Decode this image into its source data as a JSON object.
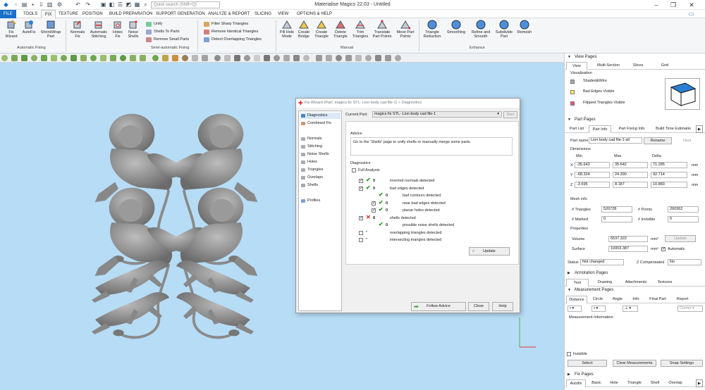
{
  "app": {
    "title": "Materialise Magics 22.03 - Untitled",
    "search_placeholder": "Quick search (Shift+Q)"
  },
  "menu": [
    "FILE",
    "TOOLS",
    "FIX",
    "TEXTURE",
    "POSITION",
    "BUILD PREPARATION",
    "SUPPORT GENERATION",
    "ANALYZE & REPORT",
    "SLICING",
    "VIEW",
    "OPTIONS & HELP"
  ],
  "ribbon": {
    "auto_fixing": {
      "label": "Automatic Fixing",
      "buttons": [
        "Fix\nWizard",
        "AutoFix",
        "ShrinkWrap\nPart"
      ]
    },
    "semi": {
      "label": "Semi-automatic Fixing",
      "large": [
        "Normals\nFix",
        "Automatic\nStitching",
        "Holes\nFix",
        "Noise\nShells"
      ],
      "small": [
        "Unify",
        "Shells To Parts",
        "Remove Small Parts"
      ]
    },
    "filters": [
      "Filter Sharp Triangles",
      "Remove Identical Triangles",
      "Detect Overlapping Triangles"
    ],
    "manual": {
      "label": "Manual",
      "buttons": [
        "Pill Hole\nMode",
        "Create\nBridge",
        "Create\nTriangle",
        "Delete\nTriangle",
        "Trim\nTriangles",
        "Translate\nPart Points",
        "Move Part\nPoints"
      ]
    },
    "enhance": {
      "label": "Enhance",
      "buttons": [
        "Triangle\nReduction",
        "Smoothing",
        "Refine and\nSmooth",
        "Subdivide\nPart",
        "Remesh"
      ]
    }
  },
  "view_pages": {
    "header": "View Pages",
    "tabs": [
      "View",
      "Multi-Section",
      "Slices",
      "Grid"
    ],
    "visualization_label": "Visualization",
    "items": [
      "Shaded&Wire",
      "Bad Edges Visible",
      "Flipped Triangles Visible"
    ]
  },
  "part_pages": {
    "header": "Part Pages",
    "tabs": [
      "Part List",
      "Part Info",
      "Part Fixing Info",
      "Build Time Estimatio"
    ],
    "part_name_label": "Part name",
    "part_name": "Lion body cad file-1-stl",
    "rename": "Rename",
    "next": "Next",
    "dimensions_label": "Dimensions",
    "col_heads": [
      "Min",
      "Max",
      "Delta"
    ],
    "rows": [
      {
        "axis": "X",
        "min": "-35.642",
        "max": "35.642",
        "delta": "71.285",
        "unit": "mm"
      },
      {
        "axis": "Y",
        "min": "-68.324",
        "max": "24.390",
        "delta": "92.714",
        "unit": "mm"
      },
      {
        "axis": "Z",
        "min": "-2.695",
        "max": "8.187",
        "delta": "10.883",
        "unit": "mm"
      }
    ],
    "mesh_label": "Mesh info",
    "triangles_label": "# Triangles",
    "triangles": "520728",
    "points_label": "# Points",
    "points": "260362",
    "marked_label": "# Marked",
    "marked": "0",
    "invisible_label": "# Invisible",
    "invisible": "0",
    "properties_label": "Properties",
    "volume_label": "Volume",
    "volume": "6537.322",
    "volume_unit": "mm³",
    "update": "Update",
    "surface_label": "Surface",
    "surface": "10003.387",
    "surface_unit": "mm²",
    "automatic": "Automatic",
    "status_label": "Status",
    "status": "Not changed",
    "compensated_label": "Z Compensated",
    "compensated": "No"
  },
  "annotation_pages": {
    "header": "Annotation Pages",
    "tabs": [
      "Text",
      "Drawing",
      "Attachments",
      "Textures"
    ]
  },
  "measurement_pages": {
    "header": "Measurement Pages",
    "tabs": [
      "Distance",
      "Circle",
      "Angle",
      "Info",
      "Final Part",
      "Report"
    ],
    "center": "Center",
    "info_label": "Measurement Information",
    "invisible": "Invisible",
    "buttons": [
      "Select",
      "Clear Measurements",
      "Snap Settings"
    ]
  },
  "fix_pages": {
    "header": "Fix Pages",
    "tabs": [
      "Autofix",
      "Basic",
      "Hole",
      "Triangle",
      "Shell",
      "Overlap"
    ]
  },
  "dialog": {
    "title": "Fix Wizard (Part: magics fix STL- Lion body cad file-1) > Diagnostics",
    "nav": [
      "Diagnostics",
      "Combined Fix",
      "Normals",
      "Stitching",
      "Noise Shells",
      "Holes",
      "Triangles",
      "Overlaps",
      "Shells",
      "Profiles"
    ],
    "current_part_label": "Current Part:",
    "current_part": "magics fix STL- Lion body cad file-1",
    "start": "Start",
    "advice_label": "Advice",
    "advice": "Go to the 'Shells' page to unify shells or manually merge some parts.",
    "diag_label": "Diagnostics",
    "full_analysis": "Full Analysis",
    "diagnostics": [
      {
        "label": "inverted normals detected",
        "count": "0",
        "state": "ok",
        "checked": true,
        "indent": 0
      },
      {
        "label": "bad edges detected",
        "count": "0",
        "state": "ok",
        "checked": true,
        "indent": 0
      },
      {
        "label": "bad contours detected",
        "count": "0",
        "state": "ok",
        "checked": false,
        "indent": 1
      },
      {
        "label": "near bad edges detected",
        "count": "0",
        "state": "ok",
        "checked": true,
        "indent": 1
      },
      {
        "label": "planar holes detected",
        "count": "0",
        "state": "ok",
        "checked": true,
        "indent": 1
      },
      {
        "label": "shells detected",
        "count": "8",
        "state": "bad",
        "checked": true,
        "indent": 0
      },
      {
        "label": "possible noise shells detected",
        "count": "0",
        "state": "ok",
        "checked": false,
        "indent": 1
      },
      {
        "label": "overlapping triangles detected",
        "count": "",
        "state": "dot",
        "checked": false,
        "indent": 0
      },
      {
        "label": "intersecting triangles detected",
        "count": "",
        "state": "dot",
        "checked": false,
        "indent": 0
      }
    ],
    "update": "Update",
    "follow": "Follow Advice",
    "close": "Close",
    "help": "Help"
  },
  "colors": {
    "accent": "#1a6fc9",
    "viewport": "#b7dcf5",
    "model": "#8e8e8e",
    "ok": "#1e9a24",
    "bad": "#d11111"
  }
}
